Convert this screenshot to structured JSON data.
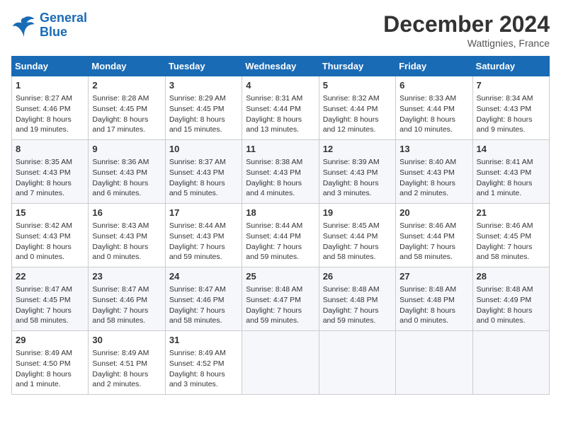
{
  "logo": {
    "line1": "General",
    "line2": "Blue"
  },
  "title": "December 2024",
  "subtitle": "Wattignies, France",
  "days_of_week": [
    "Sunday",
    "Monday",
    "Tuesday",
    "Wednesday",
    "Thursday",
    "Friday",
    "Saturday"
  ],
  "weeks": [
    [
      {
        "day": "1",
        "sunrise": "8:27 AM",
        "sunset": "4:46 PM",
        "daylight": "8 hours and 19 minutes."
      },
      {
        "day": "2",
        "sunrise": "8:28 AM",
        "sunset": "4:45 PM",
        "daylight": "8 hours and 17 minutes."
      },
      {
        "day": "3",
        "sunrise": "8:29 AM",
        "sunset": "4:45 PM",
        "daylight": "8 hours and 15 minutes."
      },
      {
        "day": "4",
        "sunrise": "8:31 AM",
        "sunset": "4:44 PM",
        "daylight": "8 hours and 13 minutes."
      },
      {
        "day": "5",
        "sunrise": "8:32 AM",
        "sunset": "4:44 PM",
        "daylight": "8 hours and 12 minutes."
      },
      {
        "day": "6",
        "sunrise": "8:33 AM",
        "sunset": "4:44 PM",
        "daylight": "8 hours and 10 minutes."
      },
      {
        "day": "7",
        "sunrise": "8:34 AM",
        "sunset": "4:43 PM",
        "daylight": "8 hours and 9 minutes."
      }
    ],
    [
      {
        "day": "8",
        "sunrise": "8:35 AM",
        "sunset": "4:43 PM",
        "daylight": "8 hours and 7 minutes."
      },
      {
        "day": "9",
        "sunrise": "8:36 AM",
        "sunset": "4:43 PM",
        "daylight": "8 hours and 6 minutes."
      },
      {
        "day": "10",
        "sunrise": "8:37 AM",
        "sunset": "4:43 PM",
        "daylight": "8 hours and 5 minutes."
      },
      {
        "day": "11",
        "sunrise": "8:38 AM",
        "sunset": "4:43 PM",
        "daylight": "8 hours and 4 minutes."
      },
      {
        "day": "12",
        "sunrise": "8:39 AM",
        "sunset": "4:43 PM",
        "daylight": "8 hours and 3 minutes."
      },
      {
        "day": "13",
        "sunrise": "8:40 AM",
        "sunset": "4:43 PM",
        "daylight": "8 hours and 2 minutes."
      },
      {
        "day": "14",
        "sunrise": "8:41 AM",
        "sunset": "4:43 PM",
        "daylight": "8 hours and 1 minute."
      }
    ],
    [
      {
        "day": "15",
        "sunrise": "8:42 AM",
        "sunset": "4:43 PM",
        "daylight": "8 hours and 0 minutes."
      },
      {
        "day": "16",
        "sunrise": "8:43 AM",
        "sunset": "4:43 PM",
        "daylight": "8 hours and 0 minutes."
      },
      {
        "day": "17",
        "sunrise": "8:44 AM",
        "sunset": "4:43 PM",
        "daylight": "7 hours and 59 minutes."
      },
      {
        "day": "18",
        "sunrise": "8:44 AM",
        "sunset": "4:44 PM",
        "daylight": "7 hours and 59 minutes."
      },
      {
        "day": "19",
        "sunrise": "8:45 AM",
        "sunset": "4:44 PM",
        "daylight": "7 hours and 58 minutes."
      },
      {
        "day": "20",
        "sunrise": "8:46 AM",
        "sunset": "4:44 PM",
        "daylight": "7 hours and 58 minutes."
      },
      {
        "day": "21",
        "sunrise": "8:46 AM",
        "sunset": "4:45 PM",
        "daylight": "7 hours and 58 minutes."
      }
    ],
    [
      {
        "day": "22",
        "sunrise": "8:47 AM",
        "sunset": "4:45 PM",
        "daylight": "7 hours and 58 minutes."
      },
      {
        "day": "23",
        "sunrise": "8:47 AM",
        "sunset": "4:46 PM",
        "daylight": "7 hours and 58 minutes."
      },
      {
        "day": "24",
        "sunrise": "8:47 AM",
        "sunset": "4:46 PM",
        "daylight": "7 hours and 58 minutes."
      },
      {
        "day": "25",
        "sunrise": "8:48 AM",
        "sunset": "4:47 PM",
        "daylight": "7 hours and 59 minutes."
      },
      {
        "day": "26",
        "sunrise": "8:48 AM",
        "sunset": "4:48 PM",
        "daylight": "7 hours and 59 minutes."
      },
      {
        "day": "27",
        "sunrise": "8:48 AM",
        "sunset": "4:48 PM",
        "daylight": "8 hours and 0 minutes."
      },
      {
        "day": "28",
        "sunrise": "8:48 AM",
        "sunset": "4:49 PM",
        "daylight": "8 hours and 0 minutes."
      }
    ],
    [
      {
        "day": "29",
        "sunrise": "8:49 AM",
        "sunset": "4:50 PM",
        "daylight": "8 hours and 1 minute."
      },
      {
        "day": "30",
        "sunrise": "8:49 AM",
        "sunset": "4:51 PM",
        "daylight": "8 hours and 2 minutes."
      },
      {
        "day": "31",
        "sunrise": "8:49 AM",
        "sunset": "4:52 PM",
        "daylight": "8 hours and 3 minutes."
      },
      null,
      null,
      null,
      null
    ]
  ]
}
